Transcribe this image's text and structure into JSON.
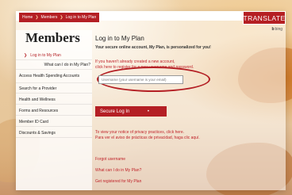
{
  "breadcrumb": {
    "items": [
      "Home",
      "Members",
      "Log in to My Plan"
    ]
  },
  "translate_label": "TRANSLATE",
  "bing_label": "bing",
  "sidebar": {
    "title": "Members",
    "items": [
      {
        "label": "Log in to My Plan"
      },
      {
        "label": "What can I do in My Plan?"
      },
      {
        "label": "Access Health Spending Accounts"
      },
      {
        "label": "Search for a Provider"
      },
      {
        "label": "Health and Wellness"
      },
      {
        "label": "Forms and Resources"
      },
      {
        "label": "Member ID Card"
      },
      {
        "label": "Discounts & Savings"
      }
    ]
  },
  "main": {
    "heading": "Log in to My Plan",
    "subheading": "Your secure online account, My Plan, is personalized for you!",
    "register_line1": "If you haven't already created a new account,",
    "register_line2": "click here to register for a new username and password.",
    "username_placeholder": "Username (your username is your email)",
    "login_button": "Secure Log In",
    "privacy_en": "To view your notice of privacy practices, click here.",
    "privacy_es": "Para ver el aviso de prácticas de privacidad, haga clic aquí.",
    "link_forgot": "Forgot username",
    "link_what": "What can I do in My Plan?",
    "link_register": "Get registered for My Plan"
  },
  "colors": {
    "brand_red": "#b41f24"
  }
}
